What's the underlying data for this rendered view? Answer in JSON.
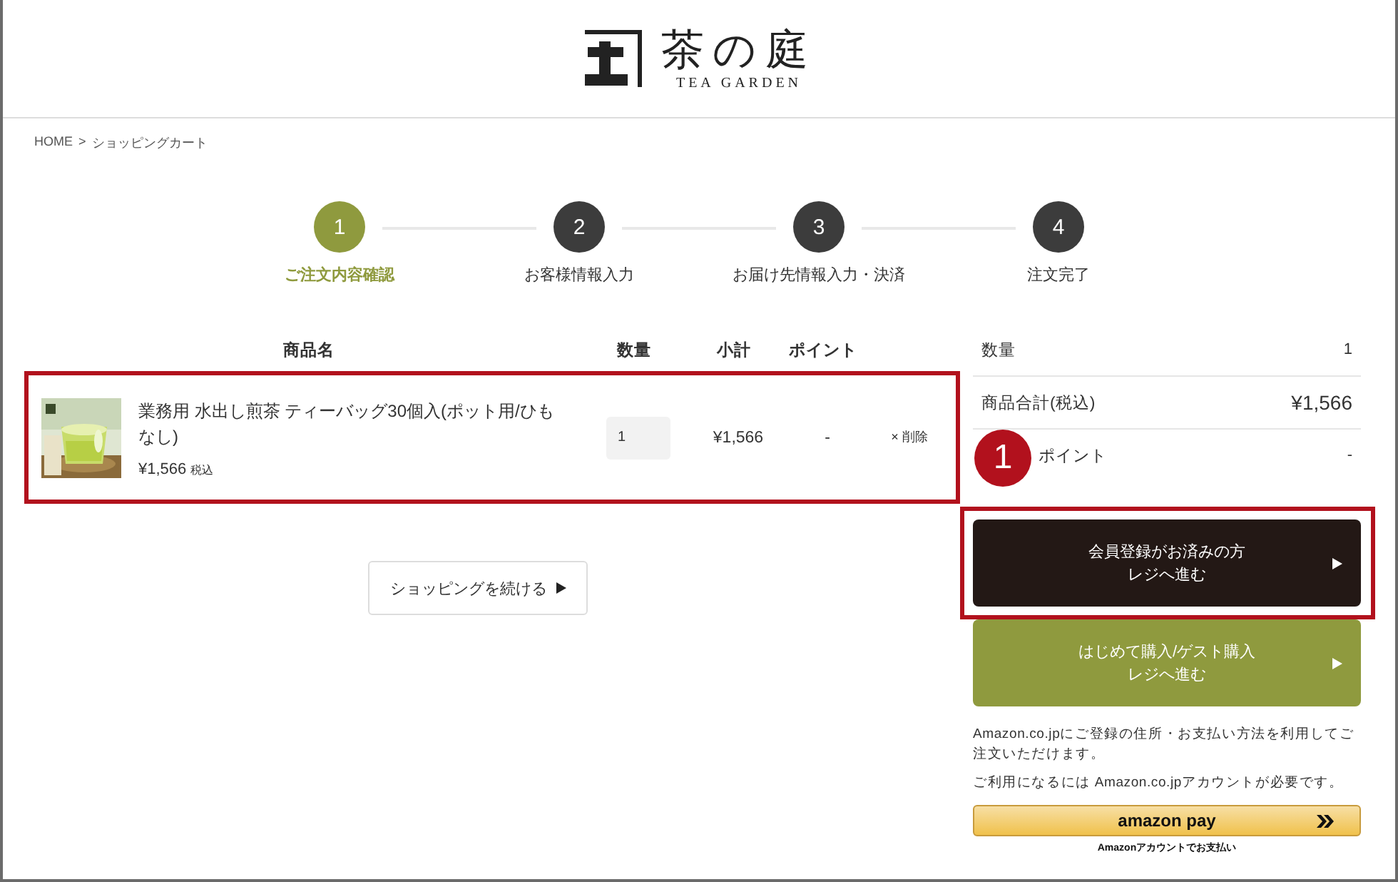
{
  "header": {
    "logo": {
      "name": "茶の庭",
      "subtitle": "TEA GARDEN"
    }
  },
  "breadcrumb": {
    "items": [
      "HOME",
      "ショッピングカート"
    ],
    "separator": ">"
  },
  "steps": [
    {
      "number": "1",
      "label": "ご注文内容確認",
      "selected": true
    },
    {
      "number": "2",
      "label": "お客様情報入力",
      "selected": false
    },
    {
      "number": "3",
      "label": "お届け先情報入力・決済",
      "selected": false
    },
    {
      "number": "4",
      "label": "注文完了",
      "selected": false
    }
  ],
  "cart": {
    "columns": [
      "商品名",
      "数量",
      "小計",
      "ポイント"
    ],
    "rows": [
      {
        "name": "業務用 水出し煎茶 ティーバッグ30個入(ポット用/ひもなし)",
        "price": "¥1,566",
        "tax_note": "税込",
        "quantity": "1",
        "subtotal": "¥1,566",
        "points": "-",
        "remove": "× 削除",
        "highlighted": true
      }
    ]
  },
  "continue_button": {
    "label": "ショッピングを続ける"
  },
  "summary": {
    "rows": [
      {
        "label": "数量",
        "value": "1",
        "kind": "count"
      },
      {
        "label": "商品合計(税込)",
        "value": "¥1,566",
        "kind": "total"
      },
      {
        "label": "ポイント",
        "value": "-",
        "kind": "points"
      }
    ]
  },
  "checkout_buttons": [
    {
      "lines": [
        "会員登録がお済みの方",
        "レジへ進む"
      ],
      "kind": "member",
      "highlighted": true
    },
    {
      "lines": [
        "はじめて購入/ゲスト購入",
        "レジへ進む"
      ],
      "kind": "guest",
      "highlighted": false
    }
  ],
  "amazon": {
    "notes": [
      "Amazon.co.jpにご登録の住所・お支払い方法を利用してご注文いただけます。",
      "ご利用になるには Amazon.co.jpアカウントが必要です。"
    ],
    "button": "amazon pay",
    "caption": "Amazonアカウントでお支払い"
  },
  "annotation": {
    "number": "1"
  }
}
